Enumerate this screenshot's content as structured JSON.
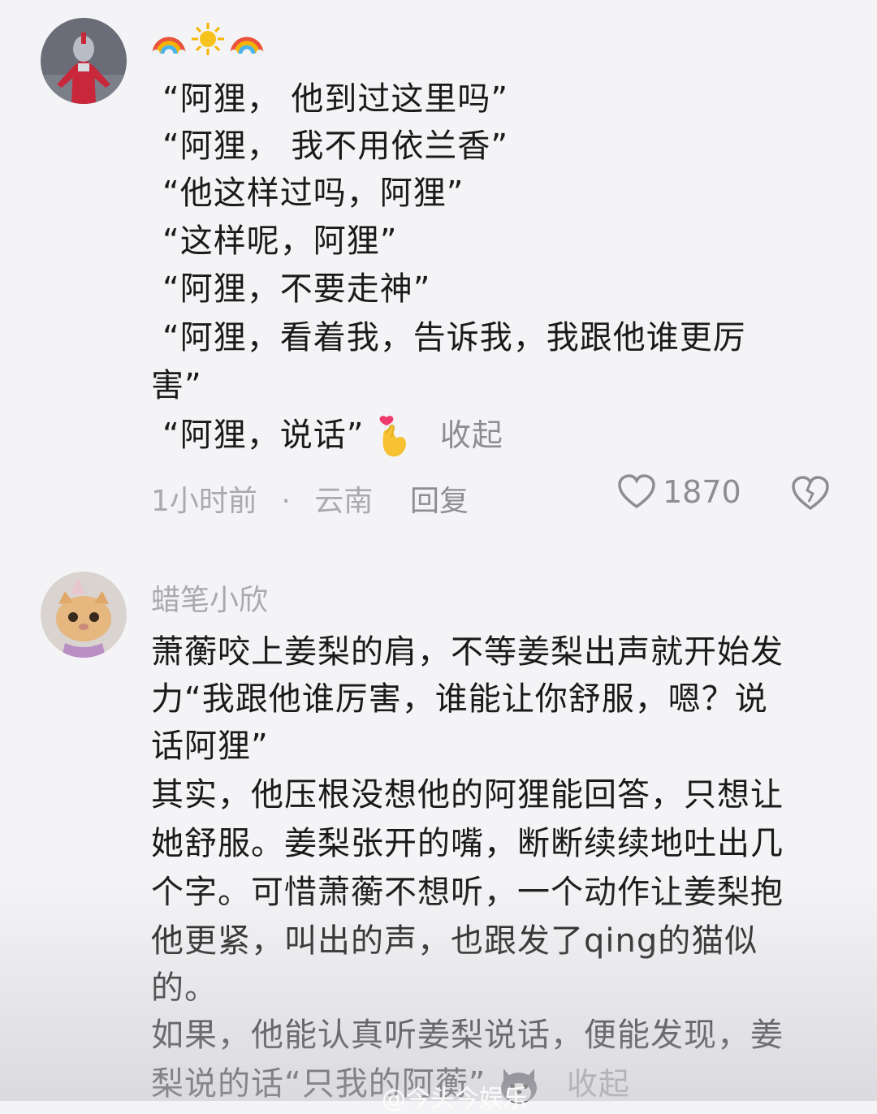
{
  "comments": [
    {
      "user": {
        "name_emoji": [
          "🌈",
          "☀",
          "🌈"
        ]
      },
      "lines": [
        "“阿狸， 他到过这里吗”",
        "“阿狸， 我不用依兰香”",
        "“他这样过吗，阿狸”",
        "“这样呢，阿狸”",
        "“阿狸，不要走神”",
        "“阿狸，看着我，告诉我，我跟他谁更厉",
        "害”",
        "“阿狸，说话”"
      ],
      "trailing_emoji": "🫰",
      "collapse_label": "收起",
      "time": "1小时前",
      "location": "云南",
      "separator": "·",
      "reply_label": "回复",
      "like_count": "1870"
    },
    {
      "user": {
        "name": "蜡笔小欣"
      },
      "lines": [
        "萧蘅咬上姜梨的肩，不等姜梨出声就开始发",
        "力“我跟他谁厉害，谁能让你舒服，嗯？说",
        "话阿狸”",
        "其实，他压根没想他的阿狸能回答，只想让",
        "她舒服。姜梨张开的嘴，断断续续地吐出几",
        "个字。可惜萧蘅不想听，一个动作让姜梨抱",
        "他更紧，叫出的声，也跟发了qing的猫似",
        "的。",
        "如果，他能认真听姜梨说话，便能发现，姜",
        "梨说的话“只我的阿蘅”"
      ],
      "collapse_label": "收起"
    }
  ],
  "watermark": "@今头今娱乐",
  "colors": {
    "muted": "#a9a9ae",
    "text": "#1a1a1a",
    "background": "#f4f4f6"
  }
}
